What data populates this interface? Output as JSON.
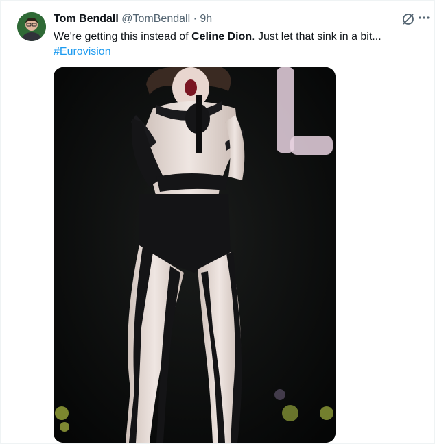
{
  "tweet": {
    "author_name": "Tom Bendall",
    "author_handle": "@TomBendall",
    "separator": "·",
    "time": "9h",
    "text_part1": "We're getting this instead of ",
    "text_bold": "Celine Dion",
    "text_part2": ". Just let that sink in a bit...",
    "hashtag": "#Eurovision"
  },
  "icons": {
    "grok": "grok-icon",
    "more": "more-options-icon"
  },
  "colors": {
    "link": "#1d9bf0",
    "secondary": "#536471",
    "primary": "#0f1419"
  }
}
